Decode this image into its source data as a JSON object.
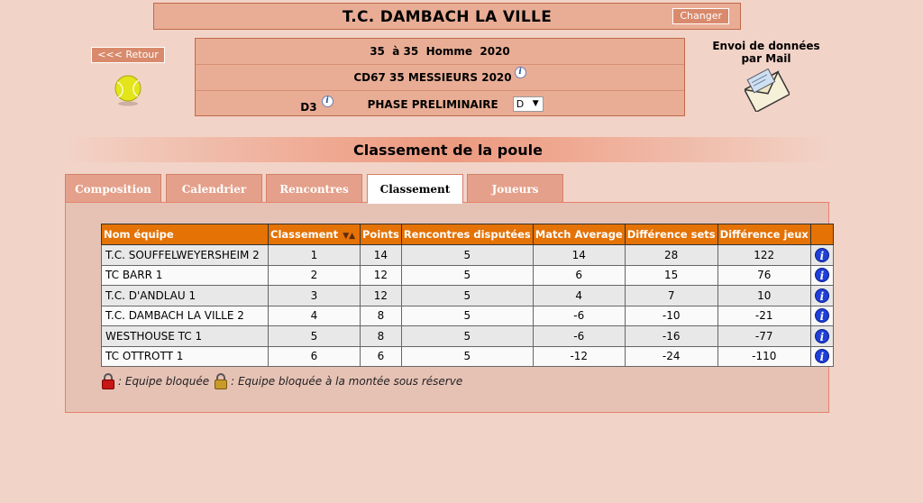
{
  "header": {
    "club_name": "T.C. DAMBACH LA VILLE",
    "change_label": "Changer"
  },
  "nav": {
    "back_label": "<<< Retour"
  },
  "competition": {
    "line1": "35  à 35  Homme  2020",
    "line2": "CD67 35 MESSIEURS 2020",
    "division": "D3",
    "phase": "PHASE PRELIMINAIRE",
    "poule_selected": "D"
  },
  "mail": {
    "title_line1": "Envoi de données",
    "title_line2": "par Mail"
  },
  "section_title": "Classement de la poule",
  "tabs": [
    {
      "label": "Composition",
      "active": false
    },
    {
      "label": "Calendrier",
      "active": false
    },
    {
      "label": "Rencontres",
      "active": false
    },
    {
      "label": "Classement",
      "active": true
    },
    {
      "label": "Joueurs",
      "active": false
    }
  ],
  "table": {
    "headers": [
      "Nom équipe",
      "Classement",
      "Points",
      "Rencontres disputées",
      "Match Average",
      "Différence sets",
      "Différence jeux"
    ],
    "rows": [
      [
        "T.C. SOUFFELWEYERSHEIM 2",
        "1",
        "14",
        "5",
        "14",
        "28",
        "122"
      ],
      [
        "TC BARR 1",
        "2",
        "12",
        "5",
        "6",
        "15",
        "76"
      ],
      [
        "T.C. D'ANDLAU 1",
        "3",
        "12",
        "5",
        "4",
        "7",
        "10"
      ],
      [
        "T.C. DAMBACH LA VILLE 2",
        "4",
        "8",
        "5",
        "-6",
        "-10",
        "-21"
      ],
      [
        "WESTHOUSE TC 1",
        "5",
        "8",
        "5",
        "-6",
        "-16",
        "-77"
      ],
      [
        "TC OTTROTT 1",
        "6",
        "6",
        "5",
        "-12",
        "-24",
        "-110"
      ]
    ]
  },
  "legend": {
    "blocked": ": Equipe bloquée",
    "blocked_promotion": ": Equipe bloquée à la montée sous réserve"
  },
  "colors": {
    "background": "#f2d3c7",
    "header_orange": "#e47205",
    "info_blue": "#1f3fd8",
    "tab_inactive": "#e4a08a"
  }
}
